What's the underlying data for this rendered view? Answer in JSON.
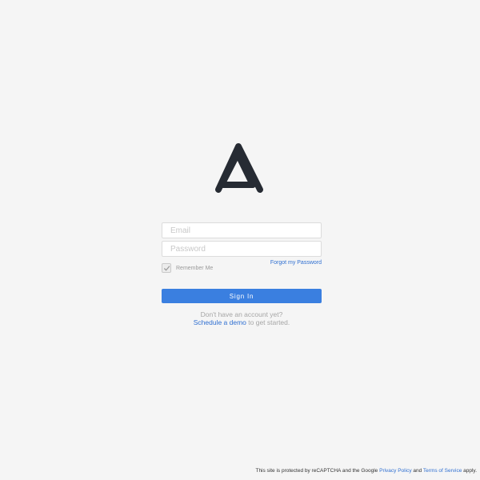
{
  "brand": {
    "logo_icon": "triangle-logo-icon",
    "logo_color": "#262b33"
  },
  "login": {
    "email_placeholder": "Email",
    "email_value": "",
    "password_placeholder": "Password",
    "password_value": "",
    "forgot_label": "Forgot my Password",
    "remember_label": "Remember Me",
    "remember_checked": true,
    "signin_label": "Sign In",
    "signup_prompt": "Don't have an account yet?",
    "demo_link": "Schedule a demo",
    "demo_suffix": " to get started."
  },
  "footer": {
    "text_before": "This site is protected by reCAPTCHA and the Google ",
    "privacy_link": "Privacy Policy",
    "text_and": " and ",
    "terms_link": "Terms of Service",
    "text_after": " apply."
  },
  "colors": {
    "background": "#f5f5f5",
    "accent": "#3a7fe0",
    "link": "#2f6fd1"
  }
}
